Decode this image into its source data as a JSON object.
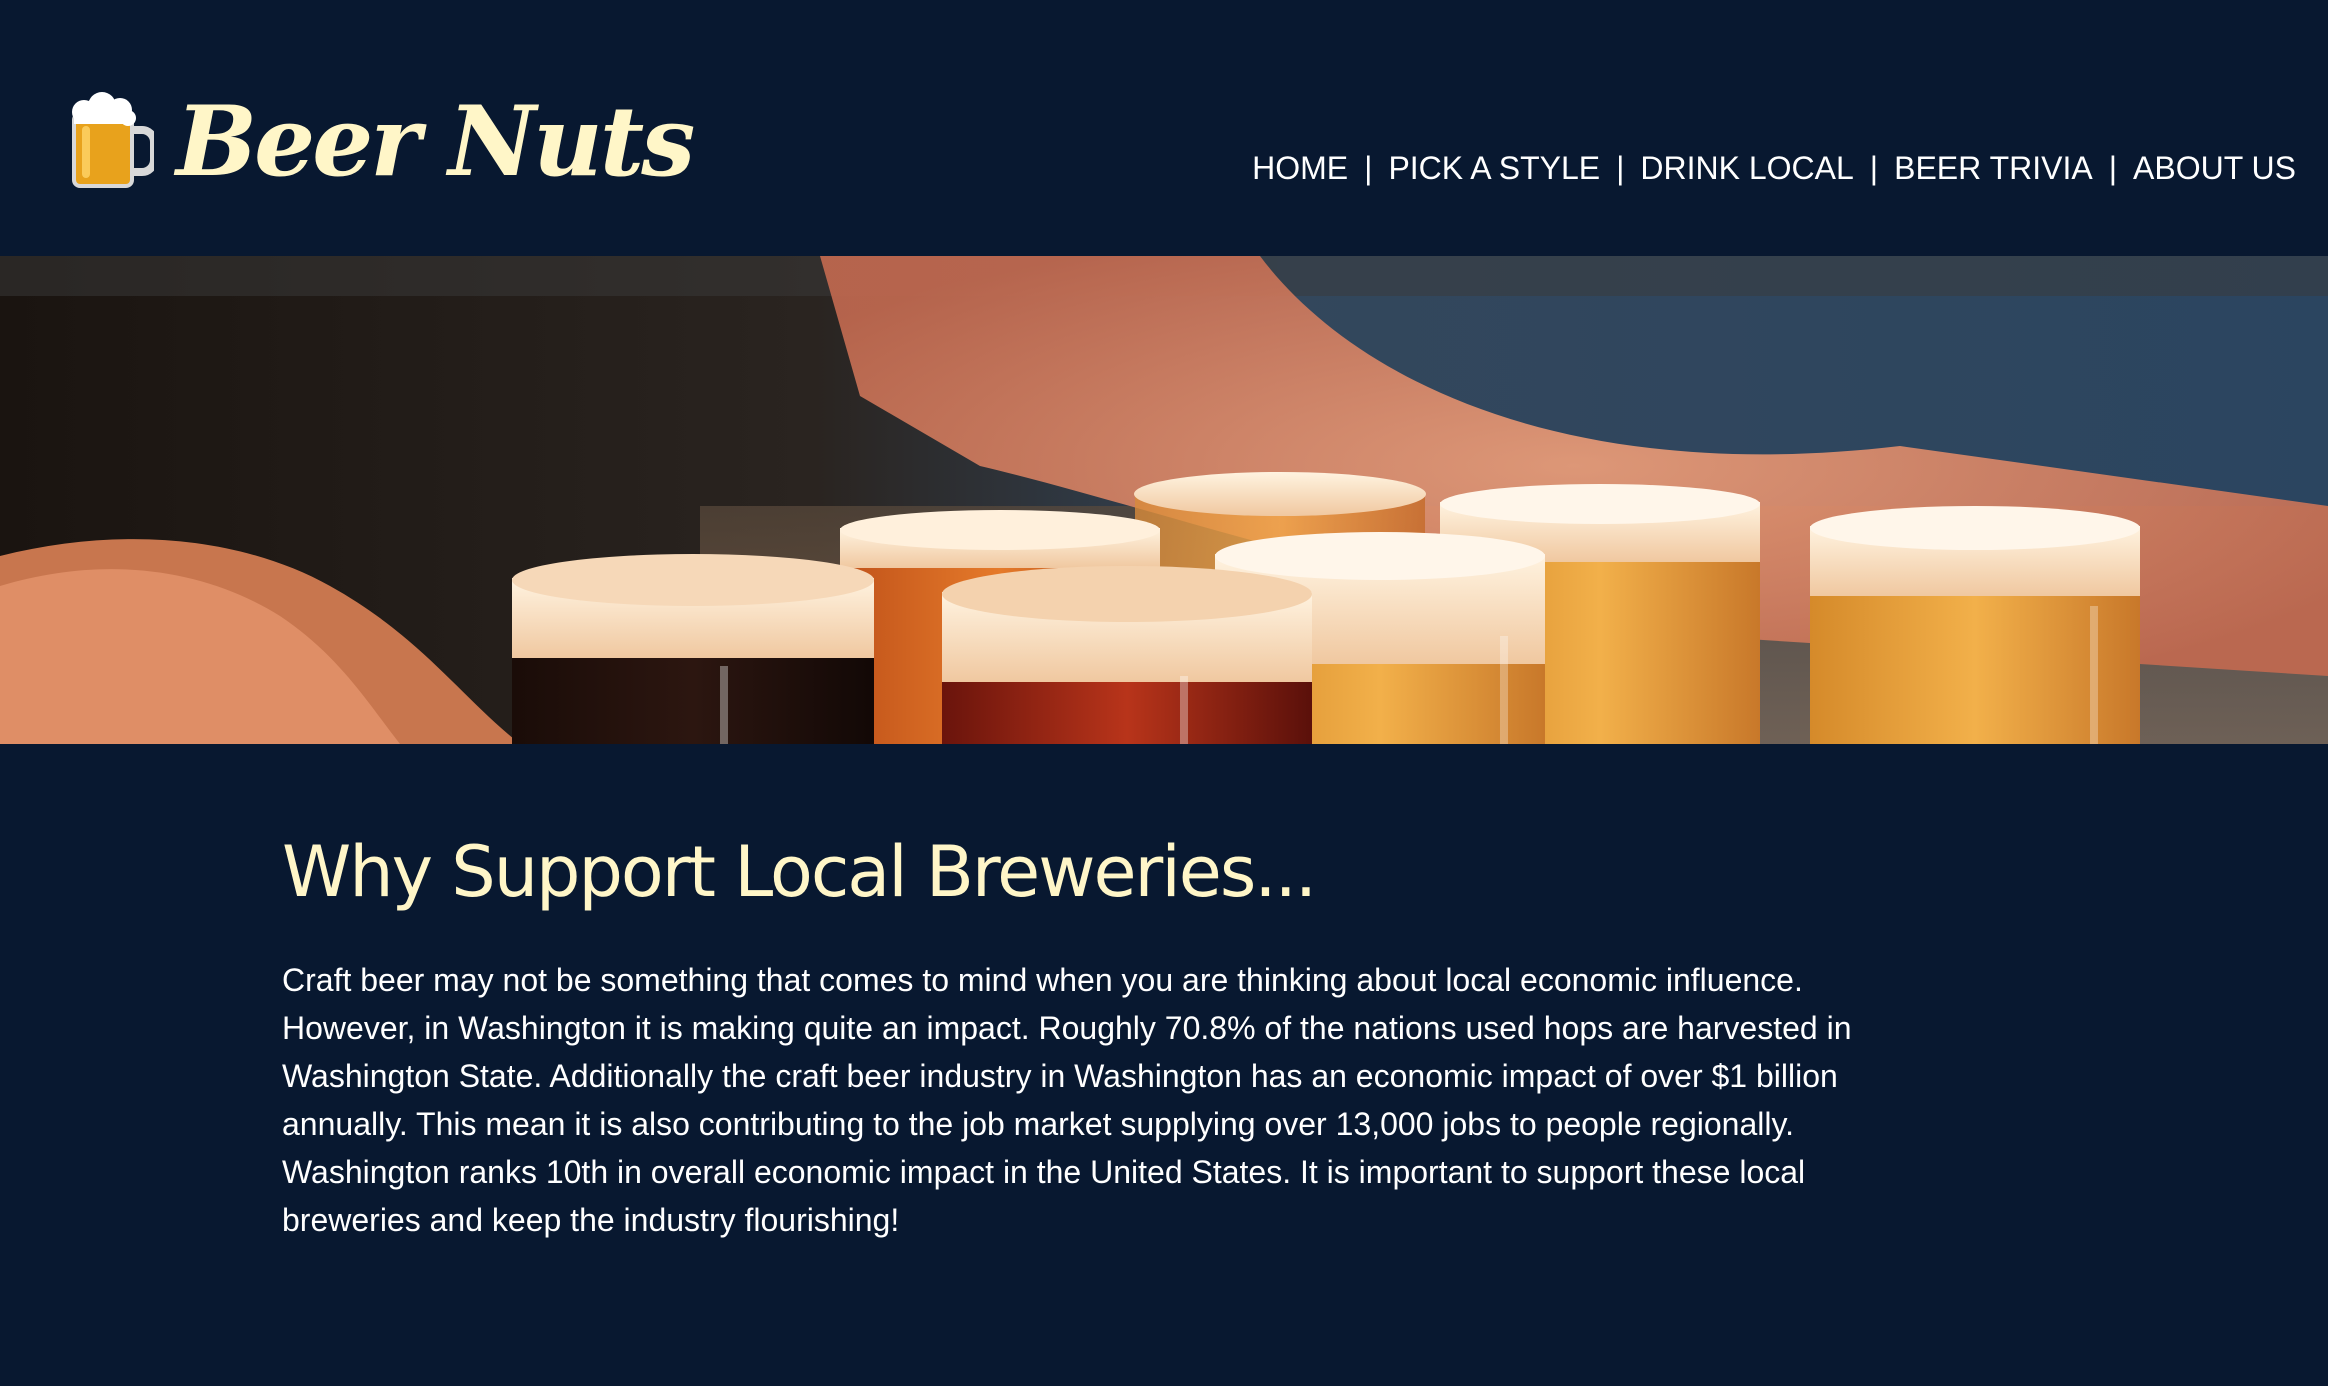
{
  "site": {
    "name": "Beer Nuts",
    "logo_icon": "beer-mug-icon"
  },
  "nav": {
    "items": [
      {
        "label": "HOME"
      },
      {
        "label": "PICK A STYLE"
      },
      {
        "label": "DRINK LOCAL"
      },
      {
        "label": "BEER TRIVIA"
      },
      {
        "label": "ABOUT US"
      }
    ],
    "separator": "|"
  },
  "hero": {
    "image": "beer-flight-photo"
  },
  "main": {
    "heading": "Why Support Local Breweries...",
    "body": "Craft beer may not be something that comes to mind when you are thinking about local economic influence. However, in Washington it is making quite an impact. Roughly 70.8% of the nations used hops are harvested in Washington State. Additionally the craft beer industry in Washington has an economic impact of over $1 billion annually. This mean it is also contributing to the job market supplying over 13,000 jobs to people regionally. Washington ranks 10th in overall economic impact in the United States. It is important to support these local breweries and keep the industry flourishing!"
  },
  "colors": {
    "background": "#081830",
    "heading": "#fff6c8",
    "text": "#ffffff"
  }
}
